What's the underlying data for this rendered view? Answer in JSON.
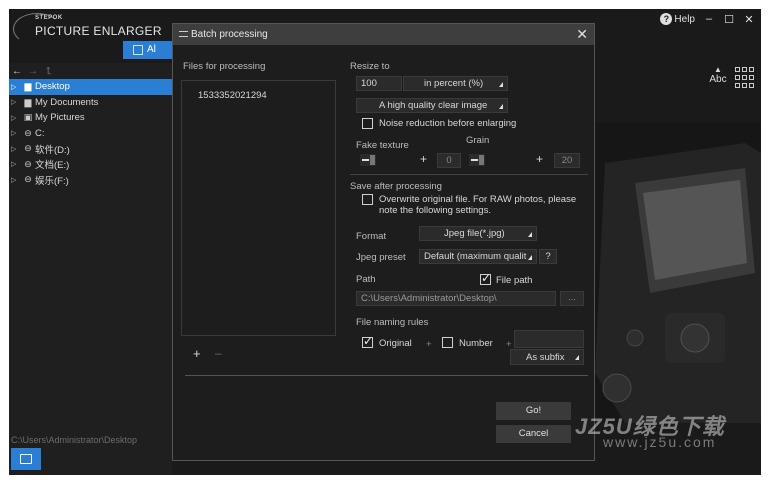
{
  "app": {
    "brand": "STEPOK",
    "name": "PICTURE ENLARGER",
    "left_tab_label": "Al",
    "help_label": "Help",
    "minimize": "–",
    "maximize": "☐",
    "close": "✕"
  },
  "nav": {
    "back": "←",
    "forward": "→",
    "up": "⮤"
  },
  "tree": [
    {
      "label": "Desktop",
      "icon": "folder-icon",
      "glyph": "▆",
      "selected": true
    },
    {
      "label": "My Documents",
      "icon": "folder-icon",
      "glyph": "▆",
      "selected": false
    },
    {
      "label": "My Pictures",
      "icon": "pictures-icon",
      "glyph": "▣",
      "selected": false
    },
    {
      "label": "C:",
      "icon": "drive-icon",
      "glyph": "⊖",
      "selected": false
    },
    {
      "label": "软件(D:)",
      "icon": "drive-icon",
      "glyph": "⊖",
      "selected": false
    },
    {
      "label": "文档(E:)",
      "icon": "drive-icon",
      "glyph": "⊖",
      "selected": false
    },
    {
      "label": "娱乐(F:)",
      "icon": "drive-icon",
      "glyph": "⊖",
      "selected": false
    }
  ],
  "status_path": "C:\\Users\\Administrator\\Desktop",
  "right": {
    "abc_label": "Abc",
    "up_arrow": "▲"
  },
  "dialog": {
    "title": "Batch processing",
    "close": "✕",
    "files_label": "Files for processing",
    "files": [
      "1533352021294"
    ],
    "add": "+",
    "remove": "–",
    "resize_label": "Resize to",
    "resize_value": "100",
    "resize_unit": "in percent  (%)",
    "quality": "A high quality clear image",
    "noise_label": "Noise reduction before enlarging",
    "noise_checked": false,
    "fake_texture_label": "Fake texture",
    "grain_label": "Grain",
    "fake_texture_plus": "+",
    "fake_texture_value": "0",
    "grain_plus": "+",
    "grain_value": "20",
    "save_label": "Save after processing",
    "overwrite_label": "Overwrite original file. For RAW photos, please note the following settings.",
    "overwrite_checked": false,
    "format_label": "Format",
    "format_value": "Jpeg file(*.jpg)",
    "jpeg_preset_label": "Jpeg preset",
    "jpeg_preset_value": "Default (maximum qualit",
    "jpeg_help": "?",
    "path_label": "Path",
    "file_path_label": "File path",
    "file_path_checked": true,
    "path_value": "C:\\Users\\Administrator\\Desktop\\",
    "path_browse": "...",
    "naming_label": "File naming rules",
    "original_label": "Original",
    "original_checked": true,
    "plus1": "+",
    "number_label": "Number",
    "number_checked": false,
    "plus2": "+",
    "subfix_value": "As subfix",
    "go": "Go!",
    "cancel": "Cancel"
  },
  "watermark": {
    "line1": "JZ5U绿色下载",
    "line2": "www.jz5u.com"
  }
}
